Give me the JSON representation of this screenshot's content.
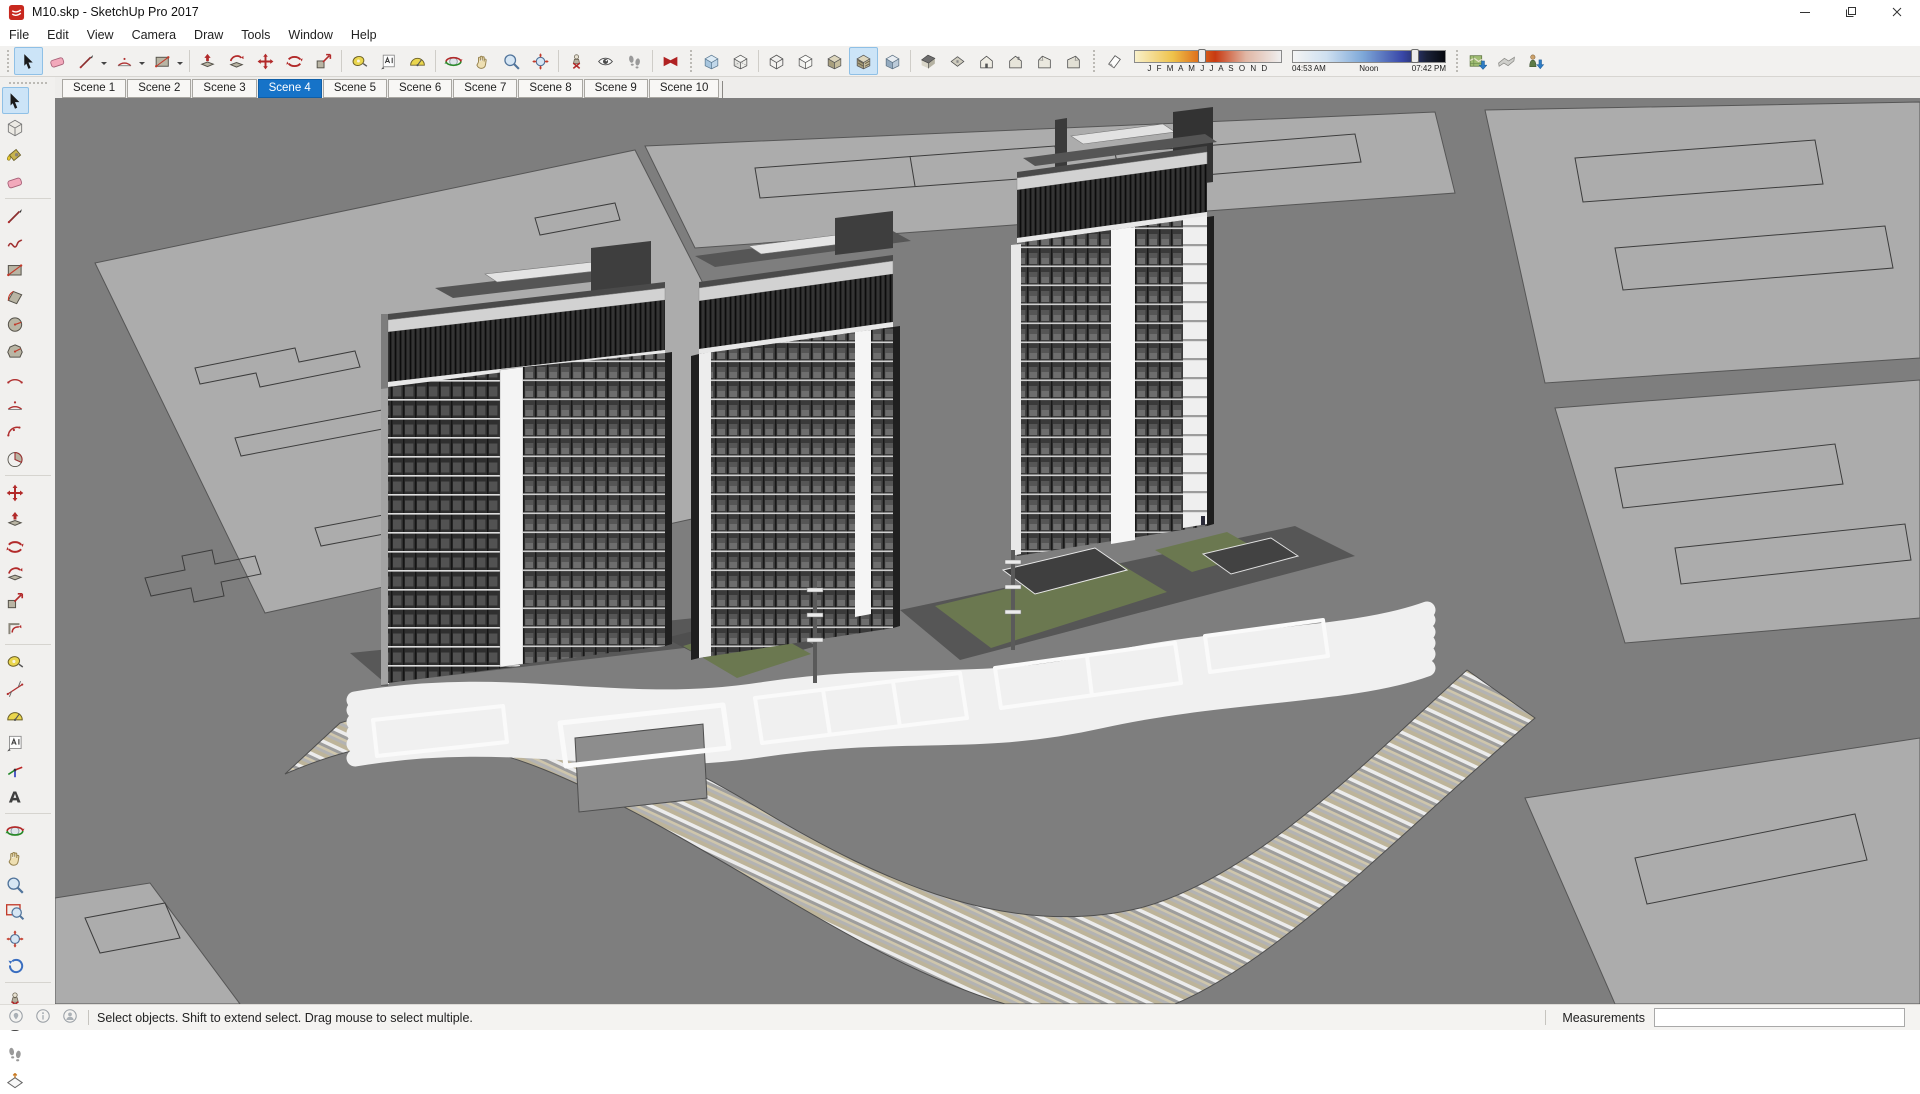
{
  "window": {
    "title": "M10.skp - SketchUp Pro 2017",
    "app_icon": "sketchup-logo",
    "controls": [
      {
        "id": "minimize"
      },
      {
        "id": "maximize"
      },
      {
        "id": "close"
      }
    ]
  },
  "menu_bar": {
    "items": [
      "File",
      "Edit",
      "View",
      "Camera",
      "Draw",
      "Tools",
      "Window",
      "Help"
    ]
  },
  "top_toolbar": {
    "active_tool": "select",
    "groups": [
      {
        "grip_before": true,
        "buttons": [
          {
            "id": "select",
            "active": true
          },
          {
            "id": "eraser"
          },
          {
            "id": "line",
            "dropdown": true
          },
          {
            "id": "two-point-arc",
            "dropdown": true
          },
          {
            "id": "rectangle",
            "dropdown": true
          }
        ]
      },
      {
        "buttons": [
          {
            "id": "push-pull"
          },
          {
            "id": "follow-me"
          },
          {
            "id": "move"
          },
          {
            "id": "rotate"
          },
          {
            "id": "scale"
          }
        ]
      },
      {
        "buttons": [
          {
            "id": "tape-measure"
          },
          {
            "id": "text"
          },
          {
            "id": "protractor"
          }
        ]
      },
      {
        "buttons": [
          {
            "id": "orbit"
          },
          {
            "id": "pan"
          },
          {
            "id": "zoom"
          },
          {
            "id": "zoom-extents"
          }
        ]
      },
      {
        "buttons": [
          {
            "id": "position-camera"
          },
          {
            "id": "look-around"
          },
          {
            "id": "walk"
          }
        ]
      },
      {
        "buttons": [
          {
            "id": "3d-warehouse"
          }
        ]
      },
      {
        "grip_before": true,
        "buttons": [
          {
            "id": "x-ray"
          },
          {
            "id": "back-edges"
          }
        ]
      },
      {
        "buttons": [
          {
            "id": "wireframe"
          },
          {
            "id": "hidden-line"
          },
          {
            "id": "shaded"
          },
          {
            "id": "shaded-with-textures",
            "active": true
          },
          {
            "id": "monochrome"
          }
        ]
      },
      {
        "buttons": [
          {
            "id": "view-iso"
          },
          {
            "id": "view-top"
          },
          {
            "id": "view-front"
          },
          {
            "id": "view-back"
          },
          {
            "id": "view-left"
          },
          {
            "id": "view-right"
          }
        ]
      },
      {
        "grip_before": true,
        "buttons": [
          {
            "id": "shadows-toggle"
          },
          {
            "id": "date-slider",
            "type": "date-slider"
          },
          {
            "id": "time-slider",
            "type": "time-slider"
          }
        ]
      },
      {
        "grip_before": true,
        "buttons": [
          {
            "id": "add-location"
          },
          {
            "id": "toggle-terrain"
          },
          {
            "id": "photo-textures"
          }
        ]
      }
    ],
    "date_slider": {
      "months_label": "J F M A M J J A S O N D",
      "handle_pos": 0.46
    },
    "time_slider": {
      "start_label": "04:53 AM",
      "noon_label": "Noon",
      "end_label": "07:42 PM",
      "handle_pos": 0.82
    }
  },
  "scene_tabs": [
    {
      "label": "Scene 1",
      "active": false
    },
    {
      "label": "Scene 2",
      "active": false
    },
    {
      "label": "Scene 3",
      "active": false
    },
    {
      "label": "Scene 4",
      "active": true
    },
    {
      "label": "Scene 5",
      "active": false
    },
    {
      "label": "Scene 6",
      "active": false
    },
    {
      "label": "Scene 7",
      "active": false
    },
    {
      "label": "Scene 8",
      "active": false
    },
    {
      "label": "Scene 9",
      "active": false
    },
    {
      "label": "Scene 10",
      "active": false
    }
  ],
  "left_toolbar": {
    "active_tool": "select",
    "rows": [
      [
        "select",
        "make-component"
      ],
      [
        "paint-bucket",
        "eraser"
      ],
      "sep",
      [
        "line",
        "freehand"
      ],
      [
        "rectangle",
        "rotated-rectangle"
      ],
      [
        "circle",
        "polygon"
      ],
      [
        "arc",
        "two-point-arc"
      ],
      [
        "three-point-arc",
        "pie"
      ],
      "sep",
      [
        "move",
        "push-pull"
      ],
      [
        "rotate",
        "follow-me"
      ],
      [
        "scale",
        "offset"
      ],
      "sep",
      [
        "tape-measure",
        "dimension"
      ],
      [
        "protractor",
        "text"
      ],
      [
        "axes",
        "3d-text"
      ],
      "sep",
      [
        "orbit",
        "pan"
      ],
      [
        "zoom",
        "zoom-window"
      ],
      [
        "zoom-extents",
        "previous-view"
      ],
      "sep",
      [
        "position-camera",
        "look-around"
      ],
      [
        "walk",
        "section-plane"
      ]
    ]
  },
  "status_bar": {
    "icons": [
      "geolocation",
      "credits",
      "sign-in"
    ],
    "message": "Select objects. Shift to extend select. Drag mouse to select multiple.",
    "measurements_label": "Measurements",
    "measurements_value": ""
  },
  "colors": {
    "accent_blue": "#1673c8",
    "toolbar_bg": "#f2f1ef",
    "selection_highlight": "#cce4f7",
    "viewport_road": "#7e7e7e",
    "viewport_parcel": "#acacac",
    "tower_facade": "#3a3a3a",
    "podium_white": "#f0f0f0",
    "landscape_green": "#6b7850",
    "paving_tan": "#bdb49a"
  }
}
